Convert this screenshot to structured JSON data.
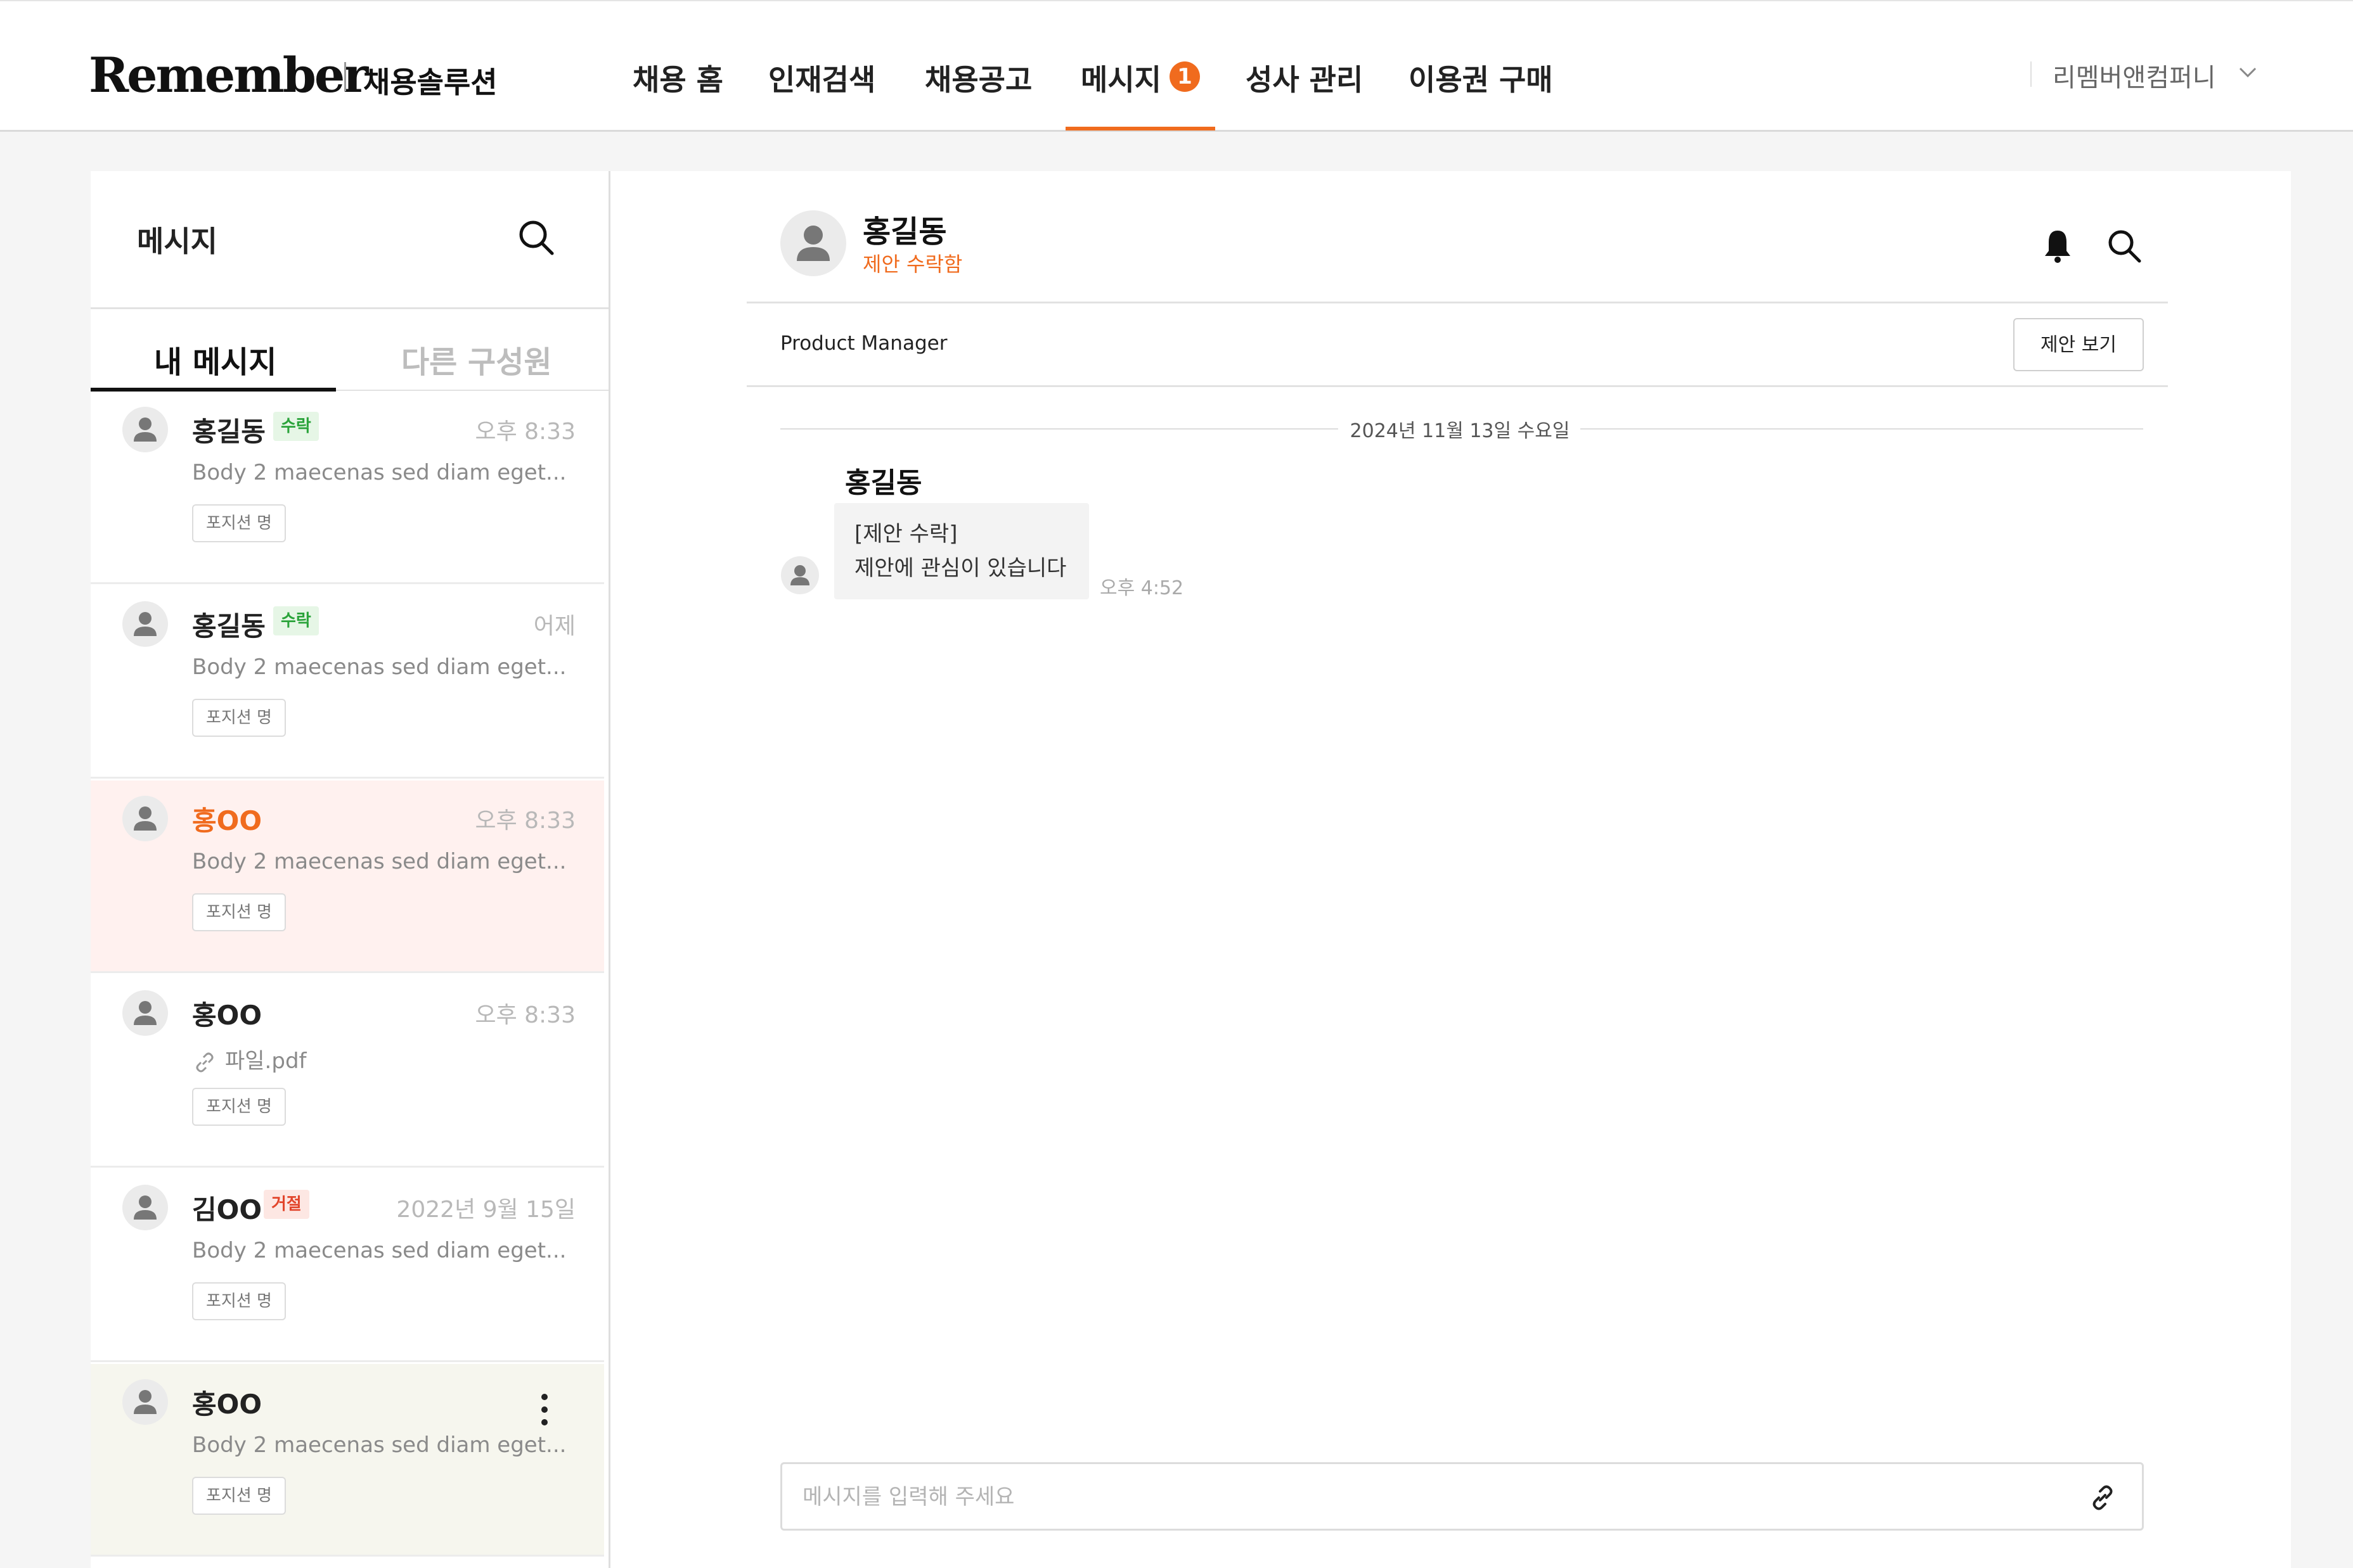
{
  "header": {
    "logo": "Remember",
    "logo_sub": "채용솔루션",
    "nav": [
      {
        "label": "채용 홈"
      },
      {
        "label": "인재검색"
      },
      {
        "label": "채용공고"
      },
      {
        "label": "메시지",
        "active": true,
        "badge": "1"
      },
      {
        "label": "성사 관리"
      },
      {
        "label": "이용권 구매"
      }
    ],
    "company": "리멤버앤컴퍼니",
    "accent_color": "#f06b1e"
  },
  "sidebar": {
    "title": "메시지",
    "tabs": [
      {
        "label": "내 메시지",
        "active": true
      },
      {
        "label": "다른 구성원",
        "active": false
      }
    ],
    "items": [
      {
        "name": "홍길동",
        "badge": "수락",
        "badge_type": "accept",
        "time": "오후 8:33",
        "preview": "Body 2 maecenas sed diam eget...",
        "tag": "포지션 명"
      },
      {
        "name": "홍길동",
        "badge": "수락",
        "badge_type": "accept",
        "time": "어제",
        "preview": "Body 2 maecenas sed diam eget...",
        "tag": "포지션 명"
      },
      {
        "name": "홍OO",
        "time": "오후 8:33",
        "preview": "Body 2 maecenas sed diam eget...",
        "tag": "포지션 명",
        "state": "active"
      },
      {
        "name": "홍OO",
        "time": "오후 8:33",
        "file": "파일.pdf",
        "tag": "포지션 명"
      },
      {
        "name": "김OO",
        "badge": "거절",
        "badge_type": "reject",
        "time": "2022년 9월 15일",
        "preview": "Body 2 maecenas sed diam eget...",
        "tag": "포지션 명"
      },
      {
        "name": "홍OO",
        "preview": "Body 2 maecenas sed diam eget...",
        "tag": "포지션 명",
        "state": "hover"
      }
    ]
  },
  "chat": {
    "name": "홍길동",
    "status": "제안 수락함",
    "job_title": "Product Manager",
    "offer_button": "제안 보기",
    "date": "2024년 11월 13일 수요일",
    "messages": [
      {
        "sender": "홍길동",
        "lines": [
          "[제안 수락]",
          "제안에 관심이 있습니다"
        ],
        "time": "오후 4:52"
      }
    ],
    "input_placeholder": "메시지를 입력해 주세요"
  }
}
